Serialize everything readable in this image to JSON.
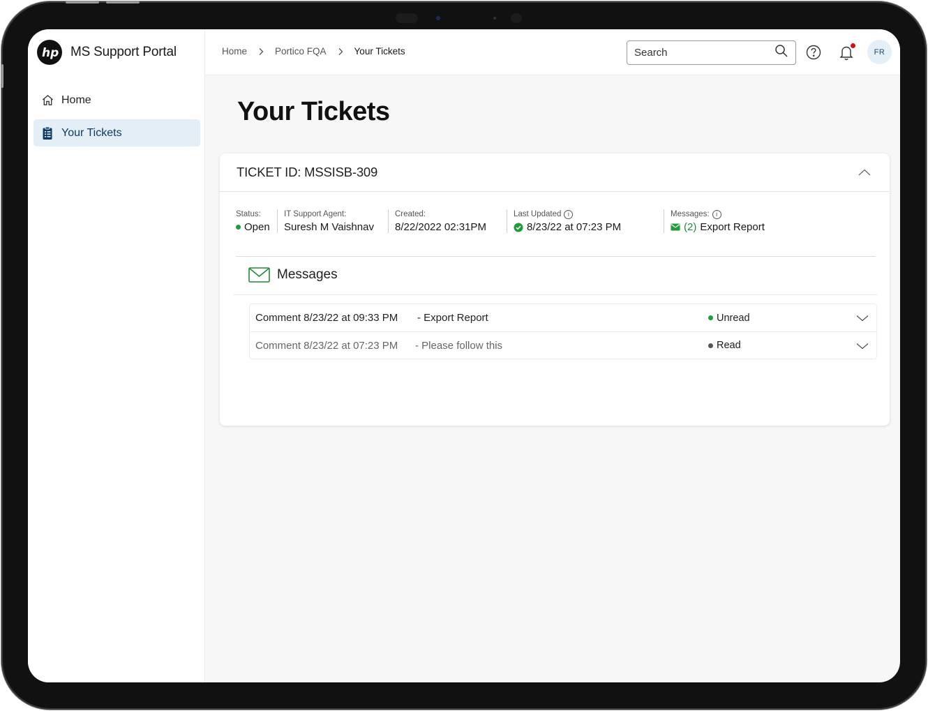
{
  "brand": {
    "name": "MS Support Portal",
    "logo_text": "hp"
  },
  "sidebar": {
    "items": [
      {
        "label": "Home",
        "icon": "home-icon",
        "active": false
      },
      {
        "label": "Your Tickets",
        "icon": "clipboard-icon",
        "active": true
      }
    ]
  },
  "header": {
    "breadcrumb": [
      "Home",
      "Portico FQA",
      "Your Tickets"
    ],
    "search_placeholder": "Search",
    "avatar_initials": "FR",
    "notification_dot": true
  },
  "page": {
    "title": "Your Tickets"
  },
  "ticket": {
    "id_label": "TICKET ID: MSSISB-309",
    "status_label": "Status:",
    "status_value": "Open",
    "agent_label": "IT Support Agent:",
    "agent_value": "Suresh M Vaishnav",
    "created_label": "Created:",
    "created_value": "8/22/2022 02:31PM",
    "updated_label": "Last Updated",
    "updated_value": "8/23/22 at 07:23 PM",
    "messages_label": "Messages:",
    "messages_count": "(2)",
    "messages_value": "Export Report"
  },
  "messages": {
    "title": "Messages",
    "rows": [
      {
        "comment": "Comment 8/23/22 at 09:33 PM",
        "subject": "- Export Report",
        "status": "Unread",
        "status_color": "#1f9d3a"
      },
      {
        "comment": "Comment 8/23/22 at 07:23 PM",
        "subject": "- Please follow this",
        "status": "Read",
        "status_color": "#555555"
      }
    ]
  },
  "colors": {
    "accent_green": "#1f9d3a",
    "active_nav_bg": "#e3eef6",
    "notification_red": "#d20f0f"
  }
}
